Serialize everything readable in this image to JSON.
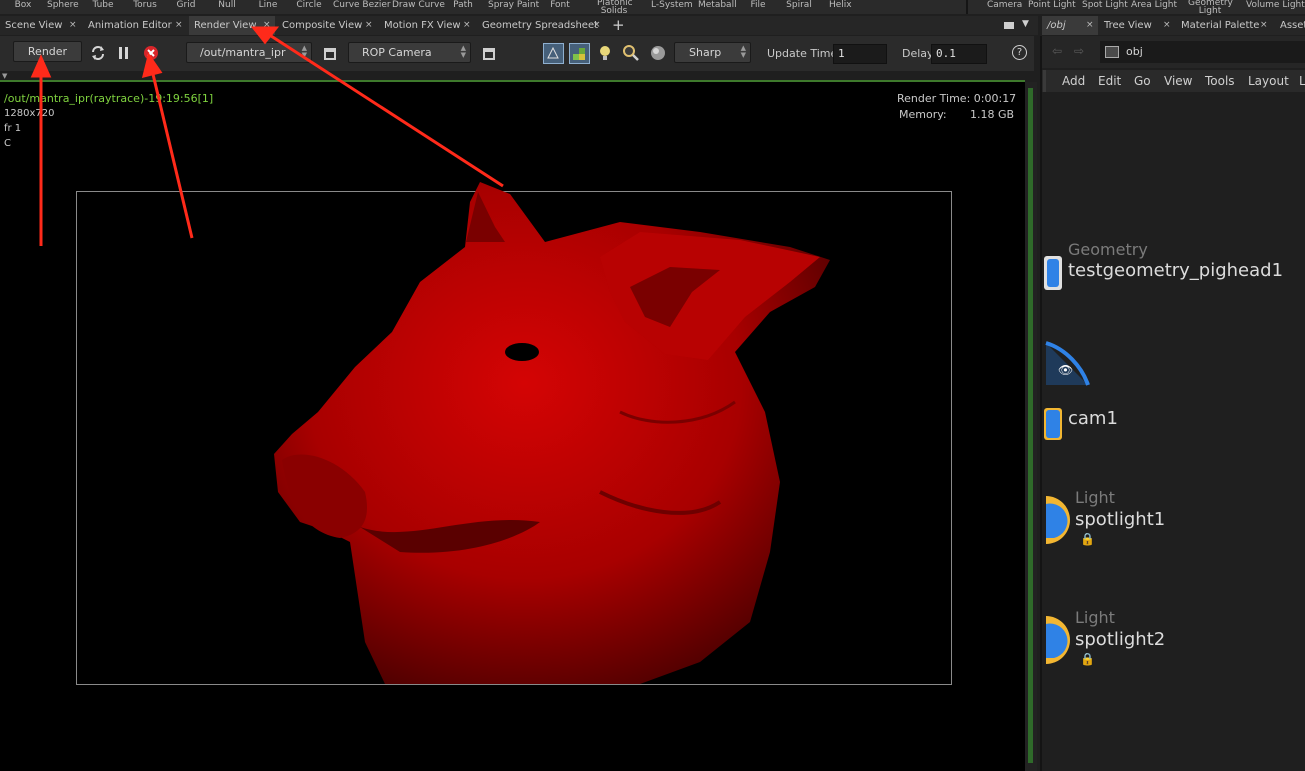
{
  "shelf": {
    "tools": [
      "Box",
      "Sphere",
      "Tube",
      "Torus",
      "Grid",
      "Null",
      "Line",
      "Circle",
      "Curve Bezier",
      "Draw Curve",
      "Path",
      "Spray Paint",
      "Font",
      "Platonic Solids",
      "L-System",
      "Metaball",
      "File",
      "Spiral",
      "Helix",
      "Camera",
      "Point Light",
      "Spot Light",
      "Area Light",
      "Geometry Light",
      "Volume Light"
    ]
  },
  "left_tabs": [
    "Scene View",
    "Animation Editor",
    "Render View",
    "Composite View",
    "Motion FX View",
    "Geometry Spreadsheet"
  ],
  "active_tab": "Render View",
  "right_tabs": [
    "/obj",
    "Tree View",
    "Material Palette",
    "Asset"
  ],
  "toolbar": {
    "render_label": "Render",
    "rop_path": "/out/mantra_ipr",
    "camera": "ROP Camera",
    "preview": "Sharp",
    "update_time_label": "Update Time",
    "update_time_value": "1",
    "delay_label": "Delay",
    "delay_value": "0.1",
    "help_icon": "?"
  },
  "viewport": {
    "info_line1": "/out/mantra_ipr(raytrace)-19:19:56[1]",
    "info_line2": "1280x720",
    "info_line3": "fr 1",
    "info_line4": "C",
    "render_time": "Render Time: 0:00:17",
    "memory_label": "Memory:",
    "memory_value": "1.18 GB"
  },
  "network": {
    "path": "obj",
    "menu": [
      "Add",
      "Edit",
      "Go",
      "View",
      "Tools",
      "Layout",
      "La"
    ],
    "nodes": [
      {
        "type": "Geometry",
        "name": "testgeometry_pighead1"
      },
      {
        "type": "",
        "name": "cam1"
      },
      {
        "type": "Light",
        "name": "spotlight1"
      },
      {
        "type": "Light",
        "name": "spotlight2"
      }
    ]
  },
  "colors": {
    "accent_green": "#7fd23f",
    "annotation_red": "#ff2a1a",
    "pig_red": "#c20000",
    "node_blue": "#2f82e6",
    "node_yellow": "#f2b632"
  }
}
